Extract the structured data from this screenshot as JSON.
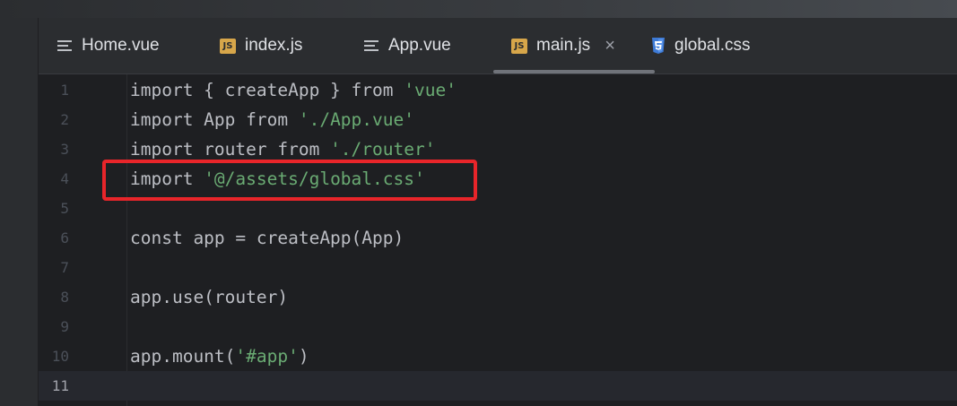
{
  "tabs": [
    {
      "label": "Home.vue",
      "icon": "text-lines-icon",
      "active": false
    },
    {
      "label": "index.js",
      "icon": "js-file-icon",
      "badge": "JS",
      "active": false
    },
    {
      "label": "App.vue",
      "icon": "text-lines-icon",
      "active": false
    },
    {
      "label": "main.js",
      "icon": "js-file-icon",
      "badge": "JS",
      "active": true,
      "close": "×"
    },
    {
      "label": "global.css",
      "icon": "css-file-icon",
      "active": false
    }
  ],
  "code_lines": [
    {
      "num": "1",
      "parts": [
        {
          "t": "import { createApp } from ",
          "c": "plain"
        },
        {
          "t": "'vue'",
          "c": "str"
        }
      ]
    },
    {
      "num": "2",
      "parts": [
        {
          "t": "import App from ",
          "c": "plain"
        },
        {
          "t": "'./App.vue'",
          "c": "str"
        }
      ]
    },
    {
      "num": "3",
      "parts": [
        {
          "t": "import router from ",
          "c": "plain"
        },
        {
          "t": "'./router'",
          "c": "str"
        }
      ]
    },
    {
      "num": "4",
      "parts": [
        {
          "t": "import ",
          "c": "plain"
        },
        {
          "t": "'@/assets/global.css'",
          "c": "str"
        }
      ]
    },
    {
      "num": "5",
      "parts": []
    },
    {
      "num": "6",
      "parts": [
        {
          "t": "const app = createApp(App)",
          "c": "plain"
        }
      ]
    },
    {
      "num": "7",
      "parts": []
    },
    {
      "num": "8",
      "parts": [
        {
          "t": "app.use(router)",
          "c": "plain"
        }
      ]
    },
    {
      "num": "9",
      "parts": []
    },
    {
      "num": "10",
      "parts": [
        {
          "t": "app.mount(",
          "c": "plain"
        },
        {
          "t": "'#app'",
          "c": "str"
        },
        {
          "t": ")",
          "c": "plain"
        }
      ]
    },
    {
      "num": "11",
      "parts": [],
      "current": true
    }
  ],
  "annotation": {
    "color": "#e8252a",
    "target_line": "4"
  },
  "colors": {
    "string": "#6aab73",
    "text": "#bcbec4",
    "background": "#1e1f22"
  }
}
